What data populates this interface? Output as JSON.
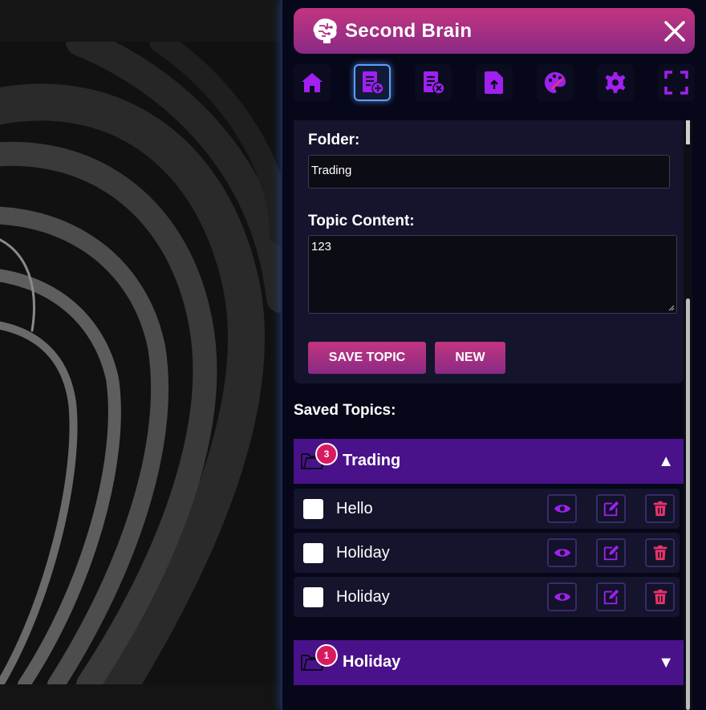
{
  "app": {
    "title": "Second Brain"
  },
  "colors": {
    "accent": "#c2357f",
    "accent_dark": "#8a2a85",
    "purple": "#a020f0",
    "folder_bg": "#4a128a",
    "badge": "#d81b60",
    "delete": "#e8336c"
  },
  "toolbar": {
    "items": [
      {
        "name": "home-icon",
        "active": false
      },
      {
        "name": "add-topic-icon",
        "active": true
      },
      {
        "name": "remove-topic-icon",
        "active": false
      },
      {
        "name": "upload-file-icon",
        "active": false
      },
      {
        "name": "palette-icon",
        "active": false
      },
      {
        "name": "settings-icon",
        "active": false
      },
      {
        "name": "fullscreen-icon",
        "active": false
      }
    ]
  },
  "form": {
    "folder_label": "Folder:",
    "folder_value": "Trading",
    "content_label": "Topic Content:",
    "content_value": "123",
    "save_label": "SAVE TOPIC",
    "new_label": "NEW"
  },
  "saved": {
    "title": "Saved Topics:",
    "folders": [
      {
        "name": "Trading",
        "count": "3",
        "expanded": true,
        "arrow": "▲",
        "topics": [
          {
            "name": "Hello"
          },
          {
            "name": "Holiday"
          },
          {
            "name": "Holiday"
          }
        ]
      },
      {
        "name": "Holiday",
        "count": "1",
        "expanded": false,
        "arrow": "▼",
        "topics": []
      }
    ]
  }
}
